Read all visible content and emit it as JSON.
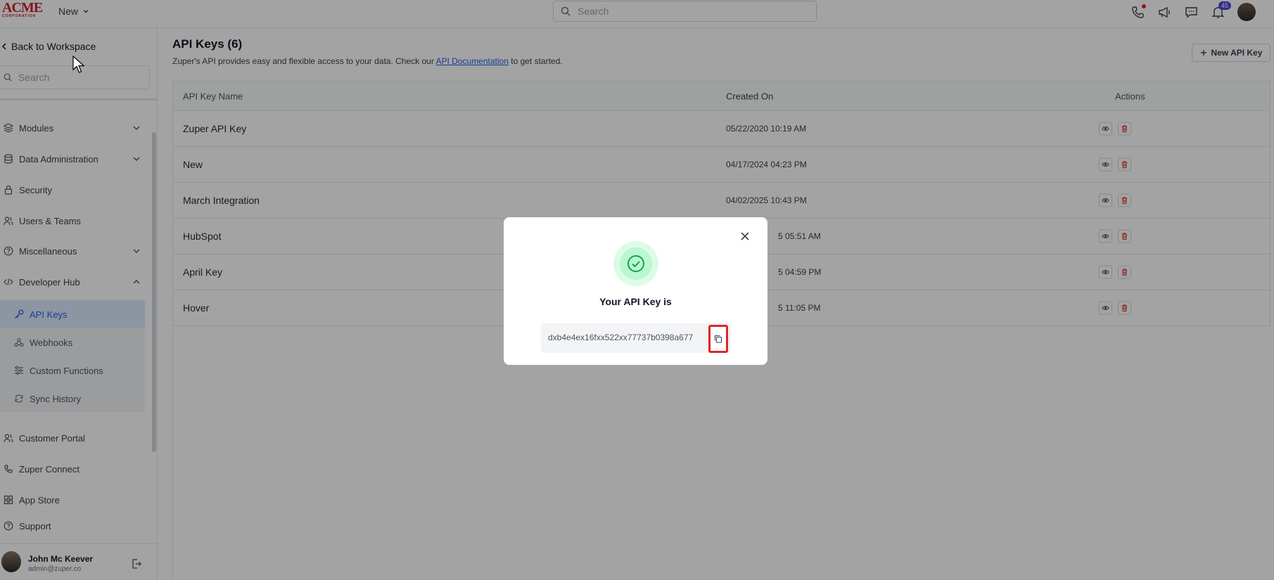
{
  "topbar": {
    "logo_text": "ACME",
    "logo_sub": "CORPORATION",
    "new_label": "New",
    "search_placeholder": "Search",
    "notification_count": "45"
  },
  "sidebar": {
    "back_label": "Back to Workspace",
    "search_placeholder": "Search",
    "items": [
      {
        "label": "Modules",
        "icon": "layers-icon"
      },
      {
        "label": "Data Administration",
        "icon": "database-icon"
      },
      {
        "label": "Security",
        "icon": "lock-icon"
      },
      {
        "label": "Users & Teams",
        "icon": "users-icon"
      },
      {
        "label": "Miscellaneous",
        "icon": "help-circle-icon"
      },
      {
        "label": "Developer Hub",
        "icon": "code-icon"
      }
    ],
    "sub_items": [
      {
        "label": "API Keys",
        "icon": "key-icon"
      },
      {
        "label": "Webhooks",
        "icon": "webhook-icon"
      },
      {
        "label": "Custom Functions",
        "icon": "sliders-icon"
      },
      {
        "label": "Sync History",
        "icon": "sync-icon"
      }
    ],
    "bottom_items": [
      {
        "label": "Customer Portal",
        "icon": "users-icon"
      },
      {
        "label": "Zuper Connect",
        "icon": "phone-icon"
      },
      {
        "label": "App Store",
        "icon": "grid-icon"
      },
      {
        "label": "Support",
        "icon": "help-circle-icon"
      }
    ],
    "user": {
      "name": "John Mc Keever",
      "email": "admin@zuper.co"
    }
  },
  "main": {
    "title": "API Keys (6)",
    "subtitle_prefix": "Zuper's API provides easy and flexible access to your data. Check our",
    "subtitle_link": "API Documentation",
    "subtitle_suffix": "to get started.",
    "new_button": "New API Key",
    "columns": [
      "API Key Name",
      "Created On",
      "Actions"
    ],
    "rows": [
      {
        "name": "Zuper API Key",
        "created": "05/22/2020 10:19 AM"
      },
      {
        "name": "New",
        "created": "04/17/2024 04:23 PM"
      },
      {
        "name": "March Integration",
        "created": "04/02/2025 10:43 PM"
      },
      {
        "name": "HubSpot",
        "created": "5 05:51 AM"
      },
      {
        "name": "April Key",
        "created": "5 04:59 PM"
      },
      {
        "name": "Hover",
        "created": "5 11:05 PM"
      }
    ]
  },
  "modal": {
    "title": "Your API Key is",
    "key_value": "dxb4e4ex16fxx522xx77737b0398a677"
  }
}
